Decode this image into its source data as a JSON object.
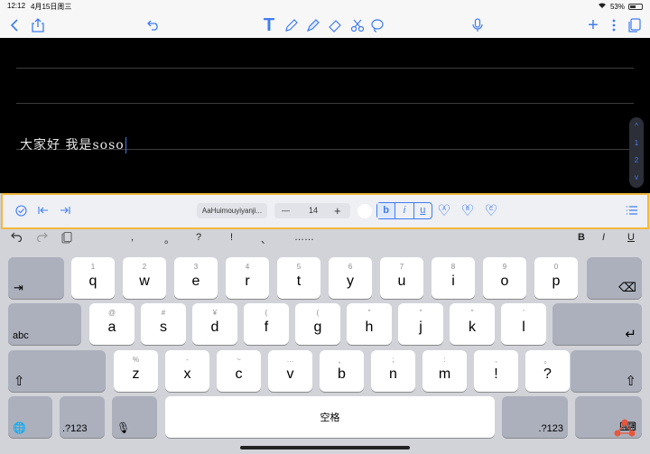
{
  "status": {
    "time": "12:12",
    "date": "4月15日周三",
    "battery_pct": "53%",
    "battery_level": 0.53
  },
  "toolbar": {
    "icons": [
      "back-chevron-icon",
      "share-icon",
      "undo-icon",
      "text-tool-icon",
      "pen-icon",
      "highlighter-icon",
      "eraser-icon",
      "scissors-icon",
      "lasso-icon",
      "microphone-icon",
      "add-icon",
      "more-icon",
      "pages-icon"
    ]
  },
  "canvas": {
    "handwriting": "大家好 我是soso",
    "page_scroller": [
      "^",
      "1",
      "2",
      "v"
    ]
  },
  "format_bar": {
    "font_name": "AaHuimouyiyanji...",
    "size_minus": "—",
    "font_size": "14",
    "size_plus": "+",
    "bold": "b",
    "italic": "i",
    "underline": "u",
    "color_presets": [
      "A",
      "B",
      "C"
    ]
  },
  "keyboard": {
    "suggestions": [
      ",",
      "。",
      "?",
      "!",
      "、",
      "……"
    ],
    "format_keys": {
      "bold": "B",
      "italic": "I",
      "underline": "U"
    },
    "row1": [
      {
        "main": "q",
        "sub": "1"
      },
      {
        "main": "w",
        "sub": "2"
      },
      {
        "main": "e",
        "sub": "3"
      },
      {
        "main": "r",
        "sub": "4"
      },
      {
        "main": "t",
        "sub": "5"
      },
      {
        "main": "y",
        "sub": "6"
      },
      {
        "main": "u",
        "sub": "7"
      },
      {
        "main": "i",
        "sub": "8"
      },
      {
        "main": "o",
        "sub": "9"
      },
      {
        "main": "p",
        "sub": "0"
      }
    ],
    "row2": [
      {
        "main": "a",
        "sub": "@"
      },
      {
        "main": "s",
        "sub": "#"
      },
      {
        "main": "d",
        "sub": "¥"
      },
      {
        "main": "f",
        "sub": "("
      },
      {
        "main": "g",
        "sub": "("
      },
      {
        "main": "h",
        "sub": "\""
      },
      {
        "main": "j",
        "sub": "\""
      },
      {
        "main": "k",
        "sub": "\""
      },
      {
        "main": "l",
        "sub": "'"
      }
    ],
    "row3": [
      {
        "main": "z",
        "sub": "%"
      },
      {
        "main": "x",
        "sub": "-"
      },
      {
        "main": "c",
        "sub": "~"
      },
      {
        "main": "v",
        "sub": "…"
      },
      {
        "main": "b",
        "sub": "、"
      },
      {
        "main": "n",
        "sub": ";"
      },
      {
        "main": "m",
        "sub": ":"
      },
      {
        "main": "!",
        "sub": ","
      },
      {
        "main": "?",
        "sub": "。"
      }
    ],
    "tab_label": "⇥",
    "delete_label": "⌫",
    "abc_label": "abc",
    "return_label": "↵",
    "shift_label": "⇧",
    "globe_label": "🌐",
    "num_label": ".?123",
    "mic_label": "🎙",
    "space_label": "空格",
    "hide_label": "⌨"
  }
}
